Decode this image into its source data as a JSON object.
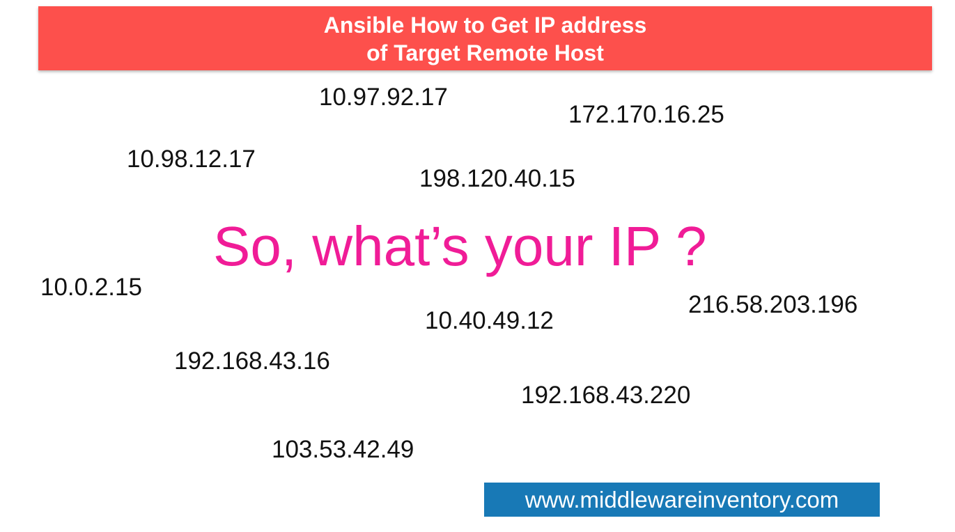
{
  "banner": {
    "line1": "Ansible How to Get IP address",
    "line2": "of Target Remote Host",
    "color": "#fd504c"
  },
  "headline": {
    "text": "So, what’s your IP ?",
    "color": "#f01c97"
  },
  "ip_addresses": [
    "10.97.92.17",
    "172.170.16.25",
    "10.98.12.17",
    "198.120.40.15",
    "10.0.2.15",
    "216.58.203.196",
    "10.40.49.12",
    "192.168.43.16",
    "192.168.43.220",
    "103.53.42.49"
  ],
  "footer": {
    "url": "www.middlewareinventory.com",
    "color": "#1879b6"
  }
}
